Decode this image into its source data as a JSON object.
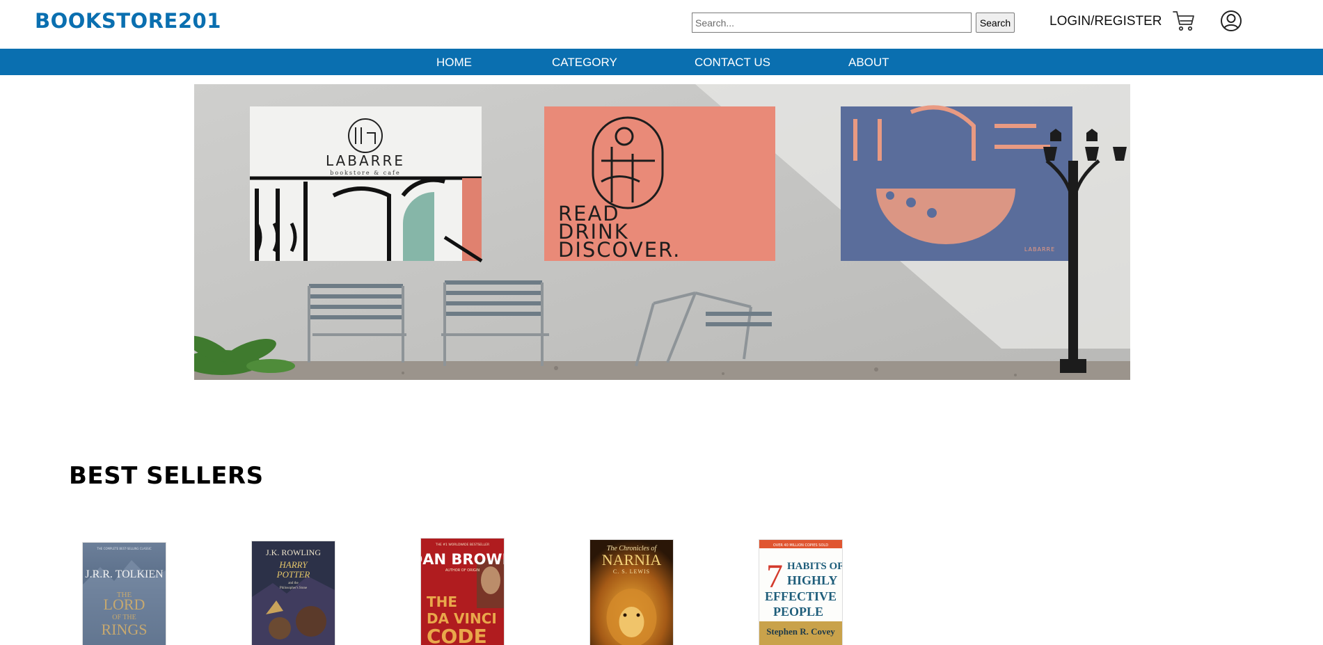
{
  "header": {
    "logo": "BOOKSTORE201",
    "search": {
      "placeholder": "Search...",
      "value": "",
      "button_label": "Search"
    },
    "login_label": "LOGIN/REGISTER",
    "icons": [
      "cart-icon",
      "user-icon"
    ]
  },
  "nav": {
    "items": [
      "HOME",
      "CATEGORY",
      "CONTACT US",
      "ABOUT"
    ]
  },
  "hero": {
    "poster1": {
      "brand": "LABARRE",
      "tagline": "bookstore & cafe"
    },
    "poster2": {
      "line1": "READ",
      "line2": "DRINK",
      "line3": "DISCOVER."
    },
    "poster3": {
      "brand": "LABARRE"
    }
  },
  "best_sellers": {
    "title": "BEST SELLERS",
    "books": [
      {
        "cover_top": "THE COMPLETE BEST-SELLING CLASSIC",
        "author": "J.R.R. TOLKIEN",
        "title_line1": "THE",
        "title_line2": "LORD",
        "title_line3": "OF THE",
        "title_line4": "RINGS"
      },
      {
        "author": "J.K. ROWLING",
        "title_line1": "HARRY",
        "title_line2": "POTTER",
        "title_line3": "and the",
        "title_line4": "Philosopher's Stone"
      },
      {
        "cover_top": "THE #1 WORLDWIDE BESTSELLER",
        "author": "DAN BROWN",
        "subtitle": "AUTHOR OF ORIGIN",
        "title_line1": "THE",
        "title_line2": "DA VINCI",
        "title_line3": "CODE"
      },
      {
        "series": "The Chronicles of",
        "title": "NARNIA",
        "author": "C. S. LEWIS"
      },
      {
        "cover_top": "OVER 40 MILLION COPIES SOLD",
        "number": "7",
        "title_line1": "HABITS OF",
        "title_line2": "HIGHLY",
        "title_line3": "EFFECTIVE",
        "title_line4": "PEOPLE",
        "author": "Stephen R. Covey"
      }
    ]
  },
  "colors": {
    "brand_blue": "#0a6fb0",
    "nav_text": "#ffffff"
  }
}
